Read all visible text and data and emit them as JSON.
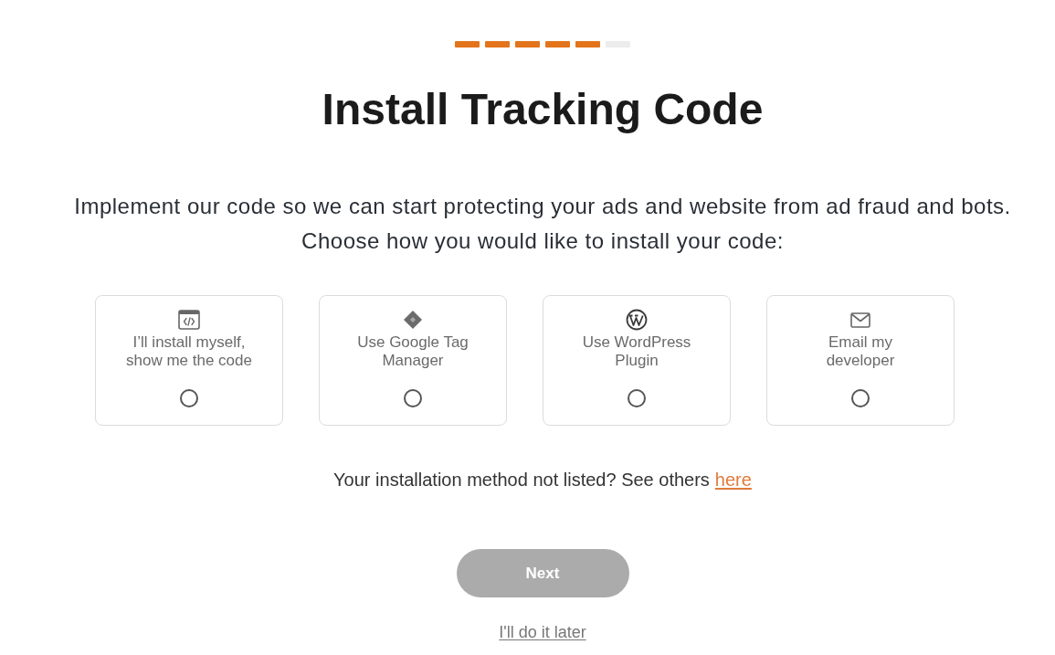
{
  "progress": {
    "steps": [
      {
        "done": true
      },
      {
        "done": true
      },
      {
        "done": true
      },
      {
        "done": true
      },
      {
        "done": true
      },
      {
        "done": false
      }
    ]
  },
  "title": "Install Tracking Code",
  "intro": "Implement our code so we can start protecting your ads and website from ad fraud and bots.",
  "prompt": "Choose how you would like to install your code:",
  "options": [
    {
      "kind": "code",
      "label": [
        "I’ll install myself,",
        "show me the code"
      ],
      "selected": false
    },
    {
      "kind": "tag_manager",
      "label": [
        "Use Google Tag",
        "Manager"
      ],
      "selected": false
    },
    {
      "kind": "wordpress",
      "label": [
        "Use WordPress",
        "Plugin"
      ],
      "selected": false
    },
    {
      "kind": "email",
      "label": [
        "Email my",
        "developer"
      ],
      "selected": false
    }
  ],
  "footer": {
    "text": "Your installation method not listed? See others",
    "link": "here"
  },
  "next_button": {
    "label": "Next",
    "disabled": true
  },
  "later_link": "I'll do it later"
}
